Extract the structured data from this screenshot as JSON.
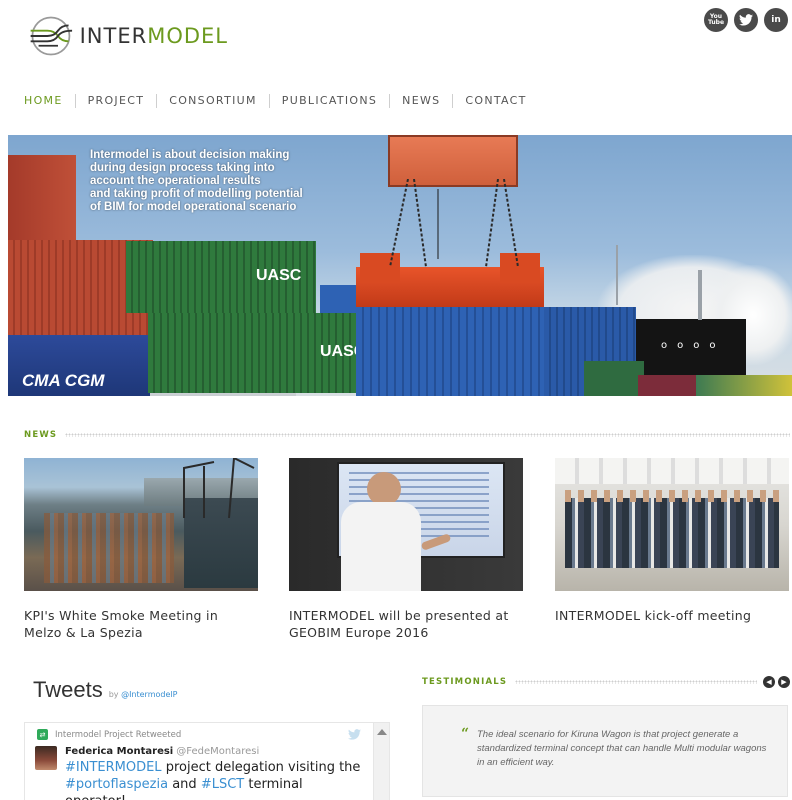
{
  "brand": {
    "name_part1": "INTER",
    "name_part2": "MODEL",
    "accent": "#6c9a1f"
  },
  "social": [
    {
      "icon": "youtube-icon",
      "label": "You Tube"
    },
    {
      "icon": "twitter-icon",
      "label": "t"
    },
    {
      "icon": "linkedin-icon",
      "label": "in"
    }
  ],
  "nav": [
    "HOME",
    "PROJECT",
    "CONSORTIUM",
    "PUBLICATIONS",
    "NEWS",
    "CONTACT"
  ],
  "hero": {
    "lines": [
      "Intermodel is about decision making",
      "during design process taking into",
      "account the operational results",
      "and taking profit of modelling potential",
      "of BIM for model operational scenario"
    ]
  },
  "news": {
    "heading": "NEWS",
    "items": [
      {
        "title": "KPI's White Smoke Meeting in Melzo & La Spezia"
      },
      {
        "title": "INTERMODEL will be presented at GEOBIM Europe 2016"
      },
      {
        "title": "INTERMODEL kick-off meeting"
      }
    ]
  },
  "tweets": {
    "title": "Tweets",
    "by": "by",
    "handle": "@IntermodelP",
    "retweet_label": "Intermodel Project Retweeted",
    "author_name": "Federica Montaresi",
    "author_screen": "@FedeMontaresi",
    "text_hashtag": "#INTERMODEL",
    "text_mid": " project delegation visiting the ",
    "text_tag2": "#portoflaspezia",
    "text_and": " and ",
    "text_tag3": "#LSCT",
    "text_end": " terminal operator!"
  },
  "testimonials": {
    "heading": "TESTIMONIALS",
    "quote": "The ideal scenario for Kiruna Wagon is that project generate a standardized terminal concept that can handle Multi modular wagons in an efficient way."
  }
}
